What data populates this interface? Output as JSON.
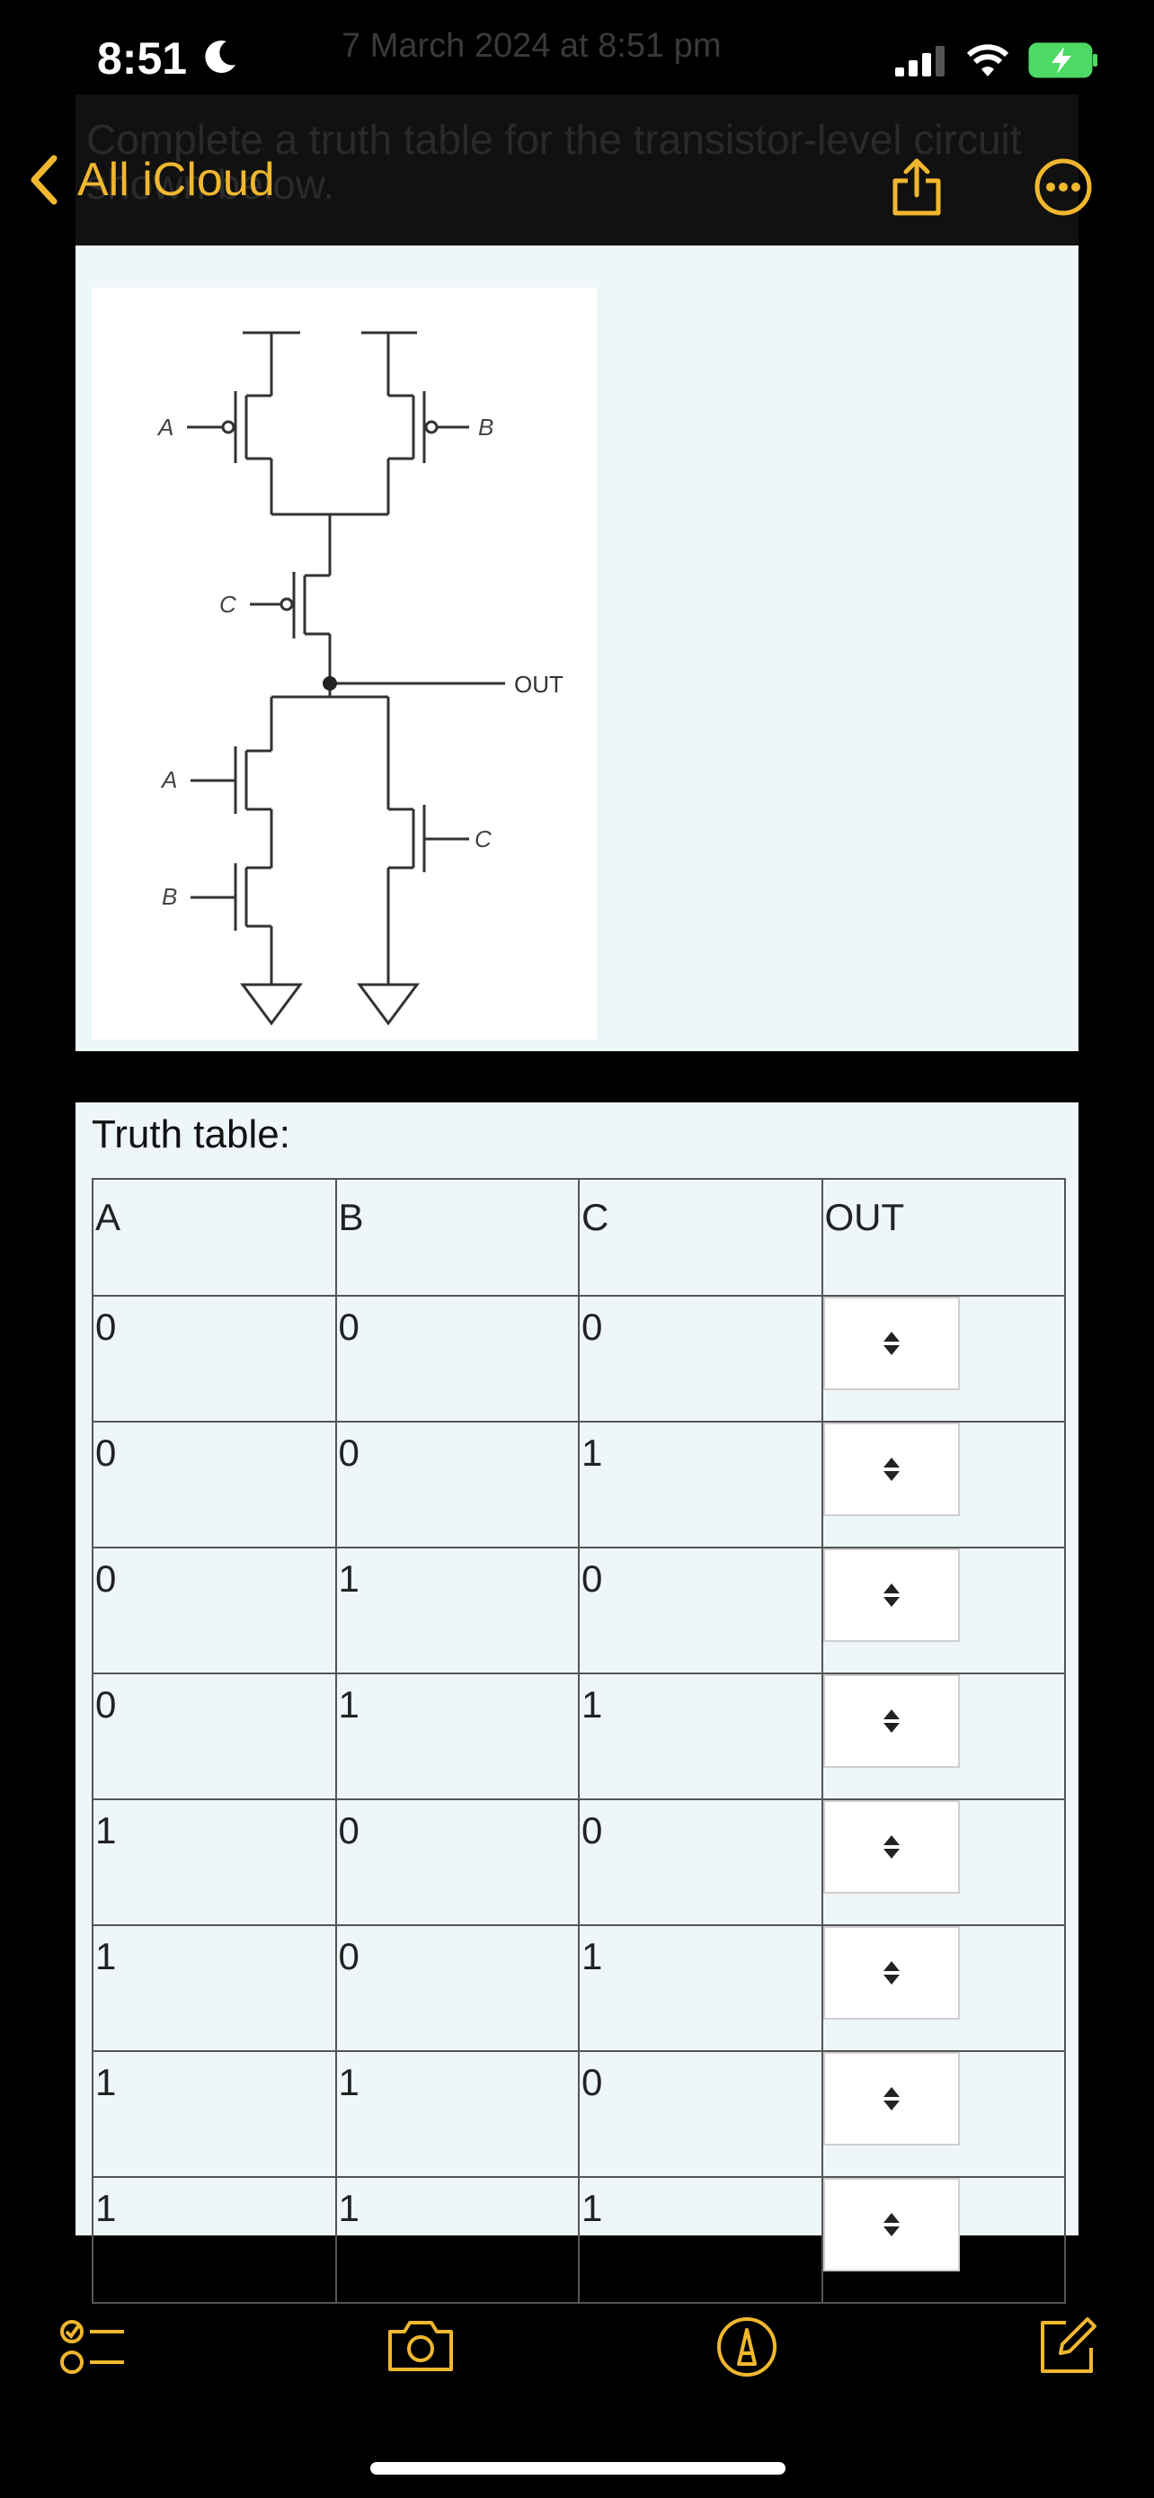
{
  "status_bar": {
    "time": "8:51",
    "ghost_date": "7 March 2024 at 8:51 pm"
  },
  "nav": {
    "back_label": "All iCloud"
  },
  "question": {
    "text": "Complete a truth table for the transistor-level circuit shown below."
  },
  "diagram": {
    "labels": [
      "A",
      "B",
      "C",
      "OUT",
      "A",
      "B",
      "C"
    ]
  },
  "truth_table": {
    "title": "Truth table:",
    "headers": [
      "A",
      "B",
      "C",
      "OUT"
    ],
    "rows": [
      [
        "0",
        "0",
        "0"
      ],
      [
        "0",
        "0",
        "1"
      ],
      [
        "0",
        "1",
        "0"
      ],
      [
        "0",
        "1",
        "1"
      ],
      [
        "1",
        "0",
        "0"
      ],
      [
        "1",
        "0",
        "1"
      ],
      [
        "1",
        "1",
        "0"
      ],
      [
        "1",
        "1",
        "1"
      ]
    ]
  },
  "colors": {
    "accent": "#f0b72f",
    "card": "#eef6f9",
    "background": "#000000"
  },
  "toolbar": {
    "icons": [
      "checklist-icon",
      "camera-icon",
      "markup-icon",
      "compose-icon"
    ]
  }
}
